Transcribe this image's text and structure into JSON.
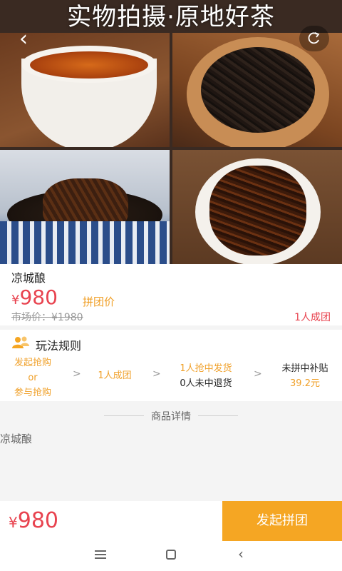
{
  "hero": {
    "banner": "实物拍摄·原地好茶",
    "back_icon": "chevron-left-icon",
    "share_icon": "share-icon"
  },
  "product": {
    "name": "凉城酿",
    "currency": "¥",
    "price": "980",
    "group_price_tag": "拼团价",
    "market_price": "市场价：¥1980",
    "group_size": "1人成团"
  },
  "rules": {
    "title": "玩法规则",
    "icon": "group-users-icon",
    "step1": {
      "line1": "发起抢购",
      "line2": "or",
      "line3": "参与抢购"
    },
    "step2": "1人成团",
    "step3": {
      "line1": "1人抢中发货",
      "line2": "0人未中退货"
    },
    "step4": {
      "line1": "未拼中补贴",
      "line2": "39.2元"
    },
    "arrow": ">"
  },
  "detail": {
    "title": "商品详情",
    "body": "凉城酿"
  },
  "bottom": {
    "currency": "¥",
    "price": "980",
    "buy_label": "发起拼团"
  },
  "colors": {
    "price_red": "#e8434f",
    "accent_orange": "#f0a029",
    "button_orange": "#f5a623"
  }
}
